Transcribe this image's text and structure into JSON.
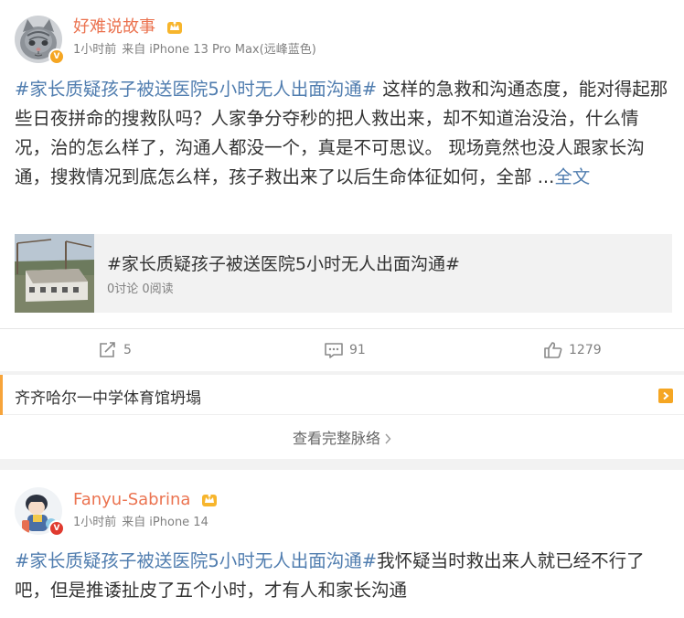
{
  "post1": {
    "username": "好难说故事",
    "time": "1小时前",
    "source_prefix": "来自",
    "source": "iPhone 13 Pro Max(远峰蓝色)",
    "hashtag": "#家长质疑孩子被送医院5小时无人出面沟通#",
    "text": " 这样的急救和沟通态度，能对得起那些日夜拼命的搜救队吗？人家争分夺秒的把人救出来，却不知道治没治，什么情况，治的怎么样了，沟通人都没一个，真是不可思议。 现场竟然也没人跟家长沟通，搜救情况到底怎么样，孩子救出来了以后生命体征如何，全部 ...",
    "full_text_link": "全文",
    "repost_card": {
      "title": "#家长质疑孩子被送医院5小时无人出面沟通#",
      "stats": "0讨论 0阅读"
    },
    "actions": {
      "repost_count": "5",
      "comment_count": "91",
      "like_count": "1279"
    }
  },
  "topic_card": {
    "label": "齐齐哈尔一中学体育馆坍塌",
    "full_context_link": "查看完整脉络"
  },
  "post2": {
    "username": "Fanyu-Sabrina",
    "time": "1小时前",
    "source_prefix": "来自",
    "source": "iPhone 14",
    "hashtag": "#家长质疑孩子被送医院5小时无人出面沟通#",
    "text": "我怀疑当时救出来人就已经不行了吧，但是推诿扯皮了五个小时，才有人和家长沟通"
  },
  "colors": {
    "username": "#eb7350",
    "link": "#507daf",
    "meta": "#808080",
    "accent_orange": "#f5a623"
  },
  "icons": [
    "crown-badge-icon",
    "verified-badge-icon",
    "repost-icon",
    "comment-icon",
    "like-icon",
    "arrow-right-icon",
    "chevron-right-icon"
  ]
}
